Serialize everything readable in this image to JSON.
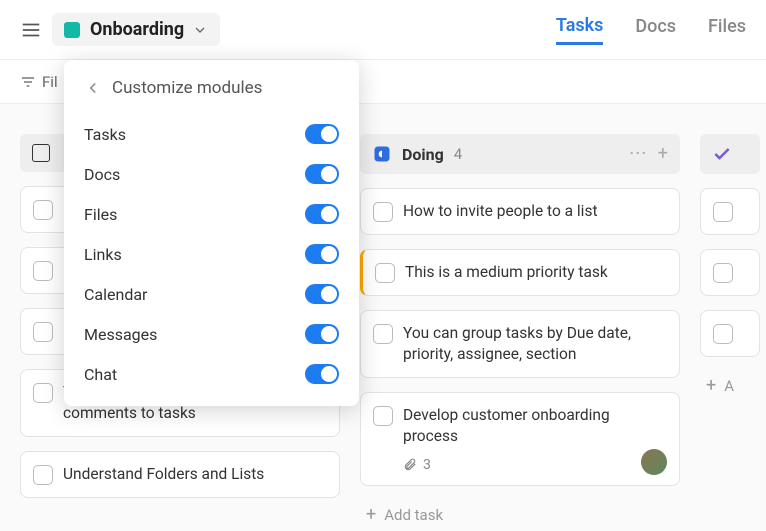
{
  "header": {
    "workspace": "Onboarding",
    "tabs": [
      {
        "label": "Tasks",
        "active": true
      },
      {
        "label": "Docs",
        "active": false
      },
      {
        "label": "Files",
        "active": false
      }
    ],
    "filter_label": "Fil"
  },
  "dropdown": {
    "title": "Customize modules",
    "items": [
      {
        "label": "Tasks",
        "on": true
      },
      {
        "label": "Docs",
        "on": true
      },
      {
        "label": "Files",
        "on": true
      },
      {
        "label": "Links",
        "on": true
      },
      {
        "label": "Calendar",
        "on": true
      },
      {
        "label": "Messages",
        "on": true
      },
      {
        "label": "Chat",
        "on": true
      }
    ]
  },
  "columns": {
    "col0": {
      "cards": [
        {
          "text": ""
        },
        {
          "text": ""
        },
        {
          "text": ""
        },
        {
          "text": "You can add subtasks, attachments, comments to tasks"
        },
        {
          "text": "Understand Folders and Lists"
        }
      ]
    },
    "doing": {
      "title": "Doing",
      "count": "4",
      "cards": [
        {
          "text": "How to invite people to a list"
        },
        {
          "text": "This is a medium priority task",
          "priority": true
        },
        {
          "text": "You can group tasks by Due date, priority, assignee, section"
        },
        {
          "text": "Develop customer onboarding process",
          "attachments": "3",
          "avatar": true
        }
      ],
      "add_label": "Add task"
    },
    "next": {
      "add_label": "A"
    }
  }
}
